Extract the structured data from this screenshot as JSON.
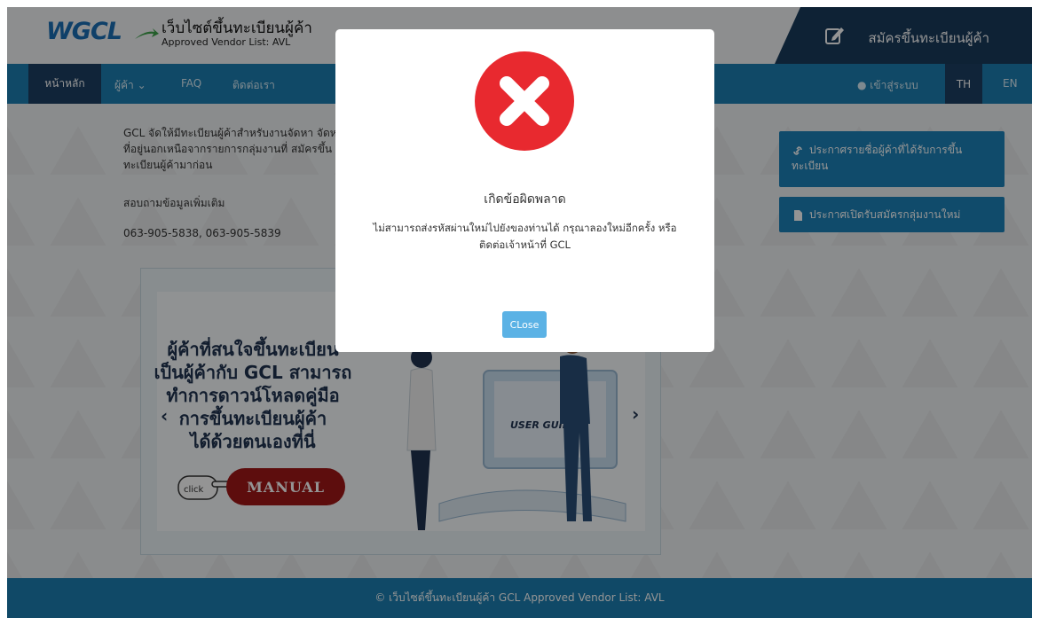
{
  "header": {
    "logo": "WGCL",
    "site_title": "เว็บไซต์ขึ้นทะเบียนผู้ค้า",
    "site_subtitle": "Approved Vendor List: AVL",
    "register_label": "สมัครขึ้นทะเบียนผู้ค้า"
  },
  "nav": {
    "home": "หน้าหลัก",
    "vendor": "ผู้ค้า ⌄",
    "faq": "FAQ",
    "contact": "ติดต่อเรา",
    "login": "เข้าสู่ระบบ",
    "lang_th": "TH",
    "lang_en": "EN"
  },
  "main": {
    "intro": "GCL จัดให้มีทะเบียนผู้ค้าสำหรับงานจัดหา จัดหาที่อยู่นอกเหนือจากรายการกลุ่มงานที่ สมัครขึ้นทะเบียนผู้ค้ามาก่อน",
    "contact_label": "สอบถามข้อมูลเพิ่มเติม",
    "phones": "063-905-5838, 063-905-5839",
    "side_btn_1": "ประกาศรายชื่อผู้ค้าที่ได้รับการขึ้นทะเบียน",
    "side_btn_2": "ประกาศเปิดรับสมัครกลุ่มงานใหม่"
  },
  "banner": {
    "heading_lines": [
      "ผู้ค้าที่สนใจขึ้นทะเบียน",
      "เป็นผู้ค้ากับ GCL สามารถ",
      "ทำการดาวน์โหลดคู่มือ",
      "การขึ้นทะเบียนผู้ค้า",
      "ได้ด้วยตนเองที่นี่"
    ],
    "click_label": "click",
    "manual_label": "MANUAL",
    "guide_label": "USER GUIDE"
  },
  "footer": {
    "text": "© เว็บไซต์ขึ้นทะเบียนผู้ค้า GCL Approved Vendor List: AVL"
  },
  "modal": {
    "title": "เกิดข้อผิดพลาด",
    "message_line1": "ไม่สามารถส่งรหัสผ่านใหม่ไปยังของท่านได้ กรุณาลองใหม่อีกครั้ง หรือ",
    "message_line2": "ติดต่อเจ้าหน้าที่ GCL",
    "close_label": "CLose"
  },
  "colors": {
    "nav_blue": "#1c7fb1",
    "dark_navy": "#193c5c",
    "error_red": "#e8292f",
    "close_button": "#5bb2e5"
  }
}
